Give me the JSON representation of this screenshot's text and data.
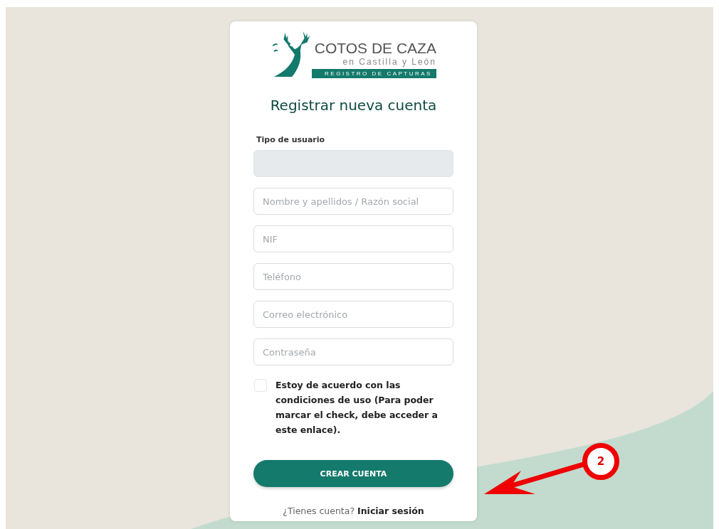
{
  "logo": {
    "title": "COTOS DE CAZA",
    "subtitle": "en Castilla y León",
    "banner": "REGISTRO DE CAPTURAS"
  },
  "heading": "Registrar nueva cuenta",
  "fields": [
    {
      "kind": "select",
      "label": "Tipo de usuario",
      "disabled": true
    },
    {
      "kind": "input",
      "placeholder": "Nombre y apellidos / Razón social"
    },
    {
      "kind": "input",
      "placeholder": "NIF"
    },
    {
      "kind": "input",
      "placeholder": "Teléfono"
    },
    {
      "kind": "input",
      "placeholder": "Correo electrónico"
    },
    {
      "kind": "input",
      "placeholder": "Contraseña"
    }
  ],
  "terms": {
    "checked": false,
    "text": "Estoy de acuerdo con las condiciones de uso (Para poder marcar el check, debe acceder a este enlace)."
  },
  "submit": "CREAR CUENTA",
  "footer": {
    "question": "¿Tienes cuenta?",
    "link": "Iniciar sesión"
  },
  "annotation": {
    "number": "2"
  }
}
